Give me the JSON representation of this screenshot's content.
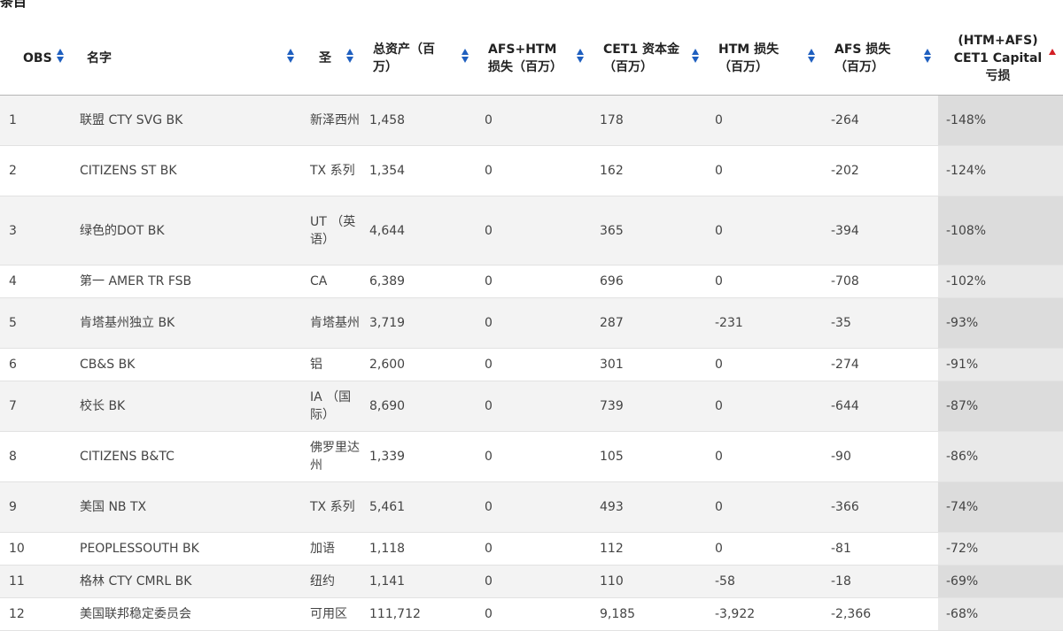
{
  "caption": "条目",
  "columns": [
    {
      "label": "OBS"
    },
    {
      "label": "名字"
    },
    {
      "label": "圣"
    },
    {
      "label": "总资产（百万）"
    },
    {
      "label": "AFS+HTM 损失（百万）"
    },
    {
      "label": "CET1 资本金（百万）"
    },
    {
      "label": "HTM 损失（百万）"
    },
    {
      "label": "AFS 损失（百万）"
    },
    {
      "label": "(HTM+AFS) CET1 Capital 亏损"
    }
  ],
  "sort": {
    "active_column": 8,
    "direction": "ascending",
    "active_color": "#d31f25",
    "arrow_color": "#1f5fbf"
  },
  "rows": [
    {
      "obs": "1",
      "name": "联盟 CTY SVG BK",
      "state": "新泽西州",
      "total_assets": "1,458",
      "afs_htm_loss": "0",
      "cet1": "178",
      "htm_loss": "0",
      "afs_loss": "-264",
      "ratio": "-148%"
    },
    {
      "obs": "2",
      "name": "CITIZENS ST BK",
      "state": "TX 系列",
      "total_assets": "1,354",
      "afs_htm_loss": "0",
      "cet1": "162",
      "htm_loss": "0",
      "afs_loss": "-202",
      "ratio": "-124%"
    },
    {
      "obs": "3",
      "name": "绿色的DOT BK",
      "state": "UT （英语）",
      "total_assets": "4,644",
      "afs_htm_loss": "0",
      "cet1": "365",
      "htm_loss": "0",
      "afs_loss": "-394",
      "ratio": "-108%"
    },
    {
      "obs": "4",
      "name": "第一 AMER TR FSB",
      "state": "CA",
      "total_assets": "6,389",
      "afs_htm_loss": "0",
      "cet1": "696",
      "htm_loss": "0",
      "afs_loss": "-708",
      "ratio": "-102%"
    },
    {
      "obs": "5",
      "name": "肯塔基州独立 BK",
      "state": "肯塔基州",
      "total_assets": "3,719",
      "afs_htm_loss": "0",
      "cet1": "287",
      "htm_loss": "-231",
      "afs_loss": "-35",
      "ratio": "-93%"
    },
    {
      "obs": "6",
      "name": "CB&S BK",
      "state": "铝",
      "total_assets": "2,600",
      "afs_htm_loss": "0",
      "cet1": "301",
      "htm_loss": "0",
      "afs_loss": "-274",
      "ratio": "-91%"
    },
    {
      "obs": "7",
      "name": "校长 BK",
      "state": "IA （国际）",
      "total_assets": "8,690",
      "afs_htm_loss": "0",
      "cet1": "739",
      "htm_loss": "0",
      "afs_loss": "-644",
      "ratio": "-87%"
    },
    {
      "obs": "8",
      "name": "CITIZENS B&TC",
      "state": "佛罗里达州",
      "total_assets": "1,339",
      "afs_htm_loss": "0",
      "cet1": "105",
      "htm_loss": "0",
      "afs_loss": "-90",
      "ratio": "-86%"
    },
    {
      "obs": "9",
      "name": "美国 NB TX",
      "state": "TX 系列",
      "total_assets": "5,461",
      "afs_htm_loss": "0",
      "cet1": "493",
      "htm_loss": "0",
      "afs_loss": "-366",
      "ratio": "-74%"
    },
    {
      "obs": "10",
      "name": "PEOPLESSOUTH BK",
      "state": "加语",
      "total_assets": "1,118",
      "afs_htm_loss": "0",
      "cet1": "112",
      "htm_loss": "0",
      "afs_loss": "-81",
      "ratio": "-72%"
    },
    {
      "obs": "11",
      "name": "格林 CTY CMRL BK",
      "state": "纽约",
      "total_assets": "1,141",
      "afs_htm_loss": "0",
      "cet1": "110",
      "htm_loss": "-58",
      "afs_loss": "-18",
      "ratio": "-69%"
    },
    {
      "obs": "12",
      "name": "美国联邦稳定委员会",
      "state": "可用区",
      "total_assets": "111,712",
      "afs_htm_loss": "0",
      "cet1": "9,185",
      "htm_loss": "-3,922",
      "afs_loss": "-2,366",
      "ratio": "-68%"
    }
  ]
}
